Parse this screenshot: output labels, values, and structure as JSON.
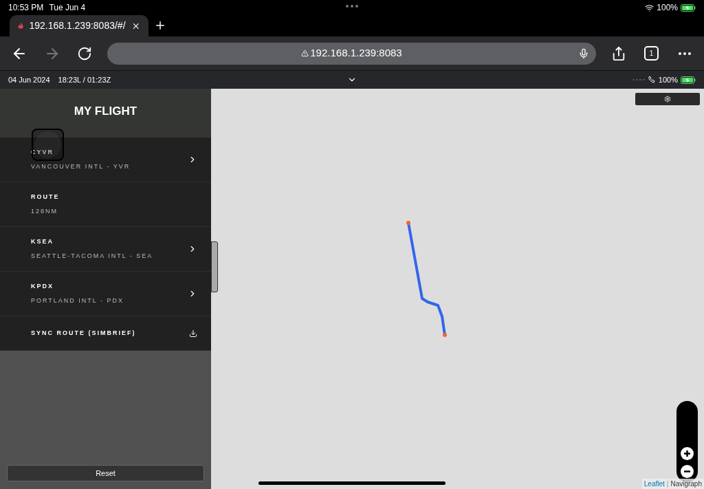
{
  "status_bar": {
    "time": "10:53 PM",
    "date": "Tue Jun 4",
    "battery": "100%"
  },
  "browser": {
    "tab_title": "192.168.1.239:8083/#/",
    "url": "192.168.1.239:8083",
    "tab_count": "1",
    "forward_disabled": true
  },
  "app_bar": {
    "date": "04 Jun 2024",
    "time": "18:23L / 01:23Z",
    "battery": "100%"
  },
  "sidebar": {
    "title": "MY FLIGHT",
    "items": [
      {
        "kind": "airport",
        "title": "CYVR",
        "subtitle": "VANCOUVER INTL - YVR"
      },
      {
        "kind": "info",
        "title": "ROUTE",
        "subtitle": "128NM"
      },
      {
        "kind": "airport",
        "title": "KSEA",
        "subtitle": "SEATTLE-TACOMA INTL - SEA"
      },
      {
        "kind": "airport",
        "title": "KPDX",
        "subtitle": "PORTLAND INTL - PDX"
      },
      {
        "kind": "action",
        "title": "SYNC ROUTE (SIMBRIEF)"
      }
    ],
    "reset_button": "Reset"
  },
  "map": {
    "attribution": [
      {
        "label": "Leaflet",
        "kind": "link"
      },
      {
        "label": "Navigraph",
        "kind": "text"
      }
    ],
    "separator": "|"
  }
}
